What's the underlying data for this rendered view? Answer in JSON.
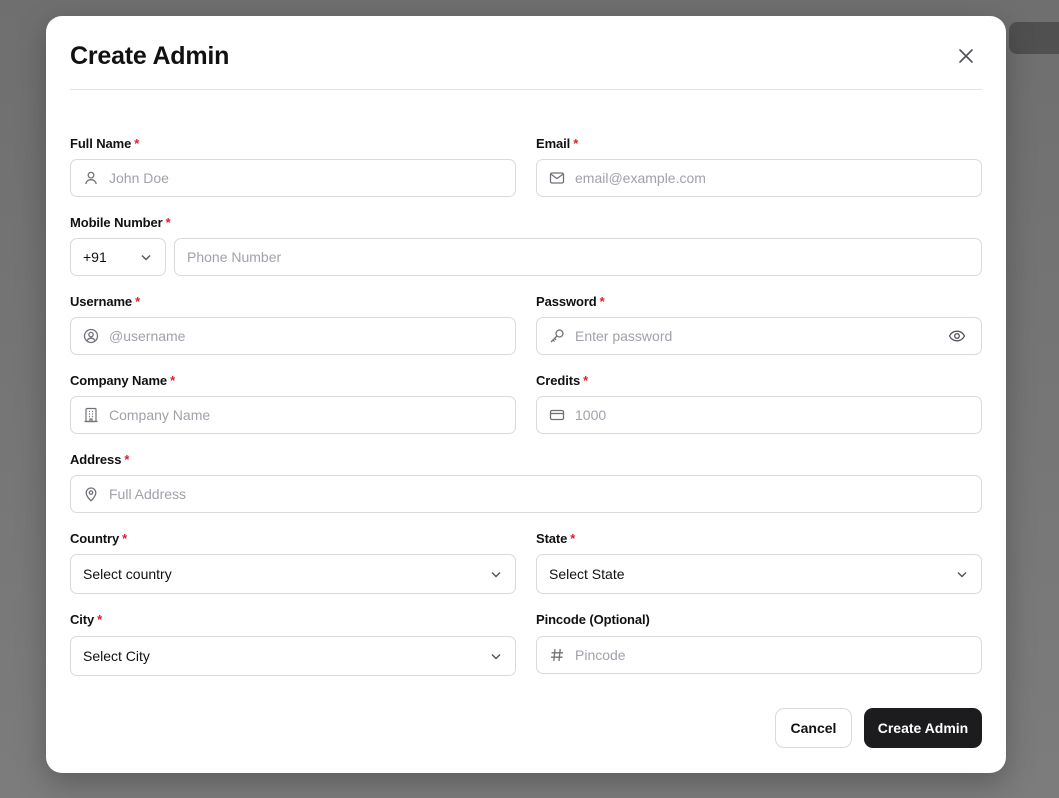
{
  "dialog": {
    "title": "Create Admin",
    "close_icon": "close-icon"
  },
  "fields": {
    "full_name": {
      "label": "Full Name",
      "required_mark": "*",
      "placeholder": "John Doe",
      "icon": "user-icon"
    },
    "email": {
      "label": "Email",
      "required_mark": "*",
      "placeholder": "email@example.com",
      "icon": "mail-icon"
    },
    "mobile": {
      "label": "Mobile Number",
      "required_mark": "*",
      "country_code": "+91",
      "placeholder": "Phone Number"
    },
    "username": {
      "label": "Username",
      "required_mark": "*",
      "placeholder": "@username",
      "icon": "user-circle-icon"
    },
    "password": {
      "label": "Password",
      "required_mark": "*",
      "placeholder": "Enter password",
      "icon": "key-icon",
      "toggle_icon": "eye-icon"
    },
    "company": {
      "label": "Company Name",
      "required_mark": "*",
      "placeholder": "Company Name",
      "icon": "building-icon"
    },
    "credits": {
      "label": "Credits",
      "required_mark": "*",
      "placeholder": "1000",
      "icon": "credit-card-icon"
    },
    "address": {
      "label": "Address",
      "required_mark": "*",
      "placeholder": "Full Address",
      "icon": "map-pin-icon"
    },
    "country": {
      "label": "Country",
      "required_mark": "*",
      "value": "Select country"
    },
    "state": {
      "label": "State",
      "required_mark": "*",
      "value": "Select State"
    },
    "city": {
      "label": "City",
      "required_mark": "*",
      "value": "Select City"
    },
    "pincode": {
      "label": "Pincode (Optional)",
      "placeholder": "Pincode",
      "icon": "hash-icon"
    }
  },
  "actions": {
    "cancel_label": "Cancel",
    "submit_label": "Create Admin"
  },
  "colors": {
    "required": "#e11d2e",
    "primary_button": "#1c1c1e",
    "border": "#d9d9de",
    "placeholder": "#a1a1aa"
  }
}
